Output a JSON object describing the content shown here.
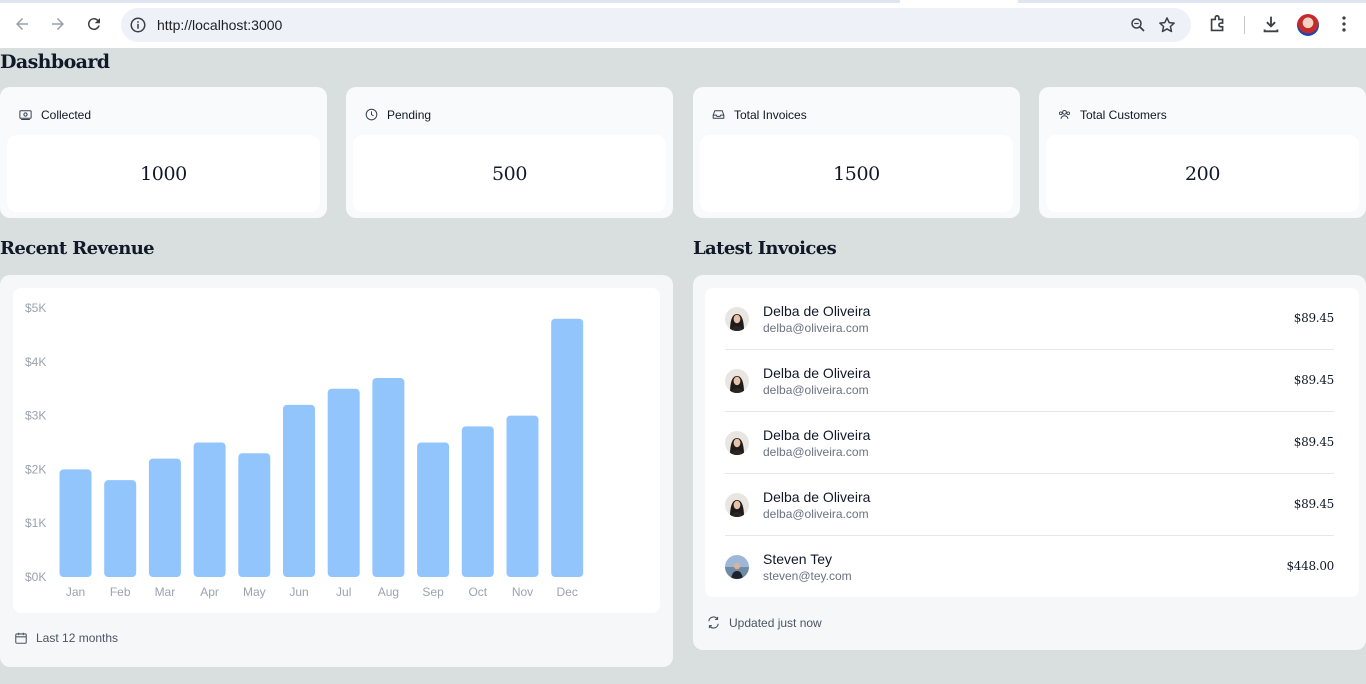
{
  "browser": {
    "url": "http://localhost:3000"
  },
  "page": {
    "title": "Dashboard",
    "cards": [
      {
        "label": "Collected",
        "value": "1000",
        "icon": "banknotes-icon"
      },
      {
        "label": "Pending",
        "value": "500",
        "icon": "clock-icon"
      },
      {
        "label": "Total Invoices",
        "value": "1500",
        "icon": "inbox-icon"
      },
      {
        "label": "Total Customers",
        "value": "200",
        "icon": "user-group-icon"
      }
    ],
    "revenue": {
      "title": "Recent Revenue",
      "footer": "Last 12 months"
    },
    "invoices": {
      "title": "Latest Invoices",
      "footer": "Updated just now",
      "rows": [
        {
          "name": "Delba de Oliveira",
          "email": "delba@oliveira.com",
          "amount": "$89.45"
        },
        {
          "name": "Delba de Oliveira",
          "email": "delba@oliveira.com",
          "amount": "$89.45"
        },
        {
          "name": "Delba de Oliveira",
          "email": "delba@oliveira.com",
          "amount": "$89.45"
        },
        {
          "name": "Delba de Oliveira",
          "email": "delba@oliveira.com",
          "amount": "$89.45"
        },
        {
          "name": "Steven Tey",
          "email": "steven@tey.com",
          "amount": "$448.00"
        }
      ]
    }
  },
  "colors": {
    "bar": "#93c5fd",
    "page_bg": "#d9dedf",
    "tick": "#9ca3af"
  },
  "chart_data": {
    "type": "bar",
    "categories": [
      "Jan",
      "Feb",
      "Mar",
      "Apr",
      "May",
      "Jun",
      "Jul",
      "Aug",
      "Sep",
      "Oct",
      "Nov",
      "Dec"
    ],
    "values": [
      2000,
      1800,
      2200,
      2500,
      2300,
      3200,
      3500,
      3700,
      2500,
      2800,
      3000,
      4800
    ],
    "yticks": [
      "$0K",
      "$1K",
      "$2K",
      "$3K",
      "$4K",
      "$5K"
    ],
    "ylim": [
      0,
      5000
    ],
    "grid": false,
    "legend": "none"
  }
}
